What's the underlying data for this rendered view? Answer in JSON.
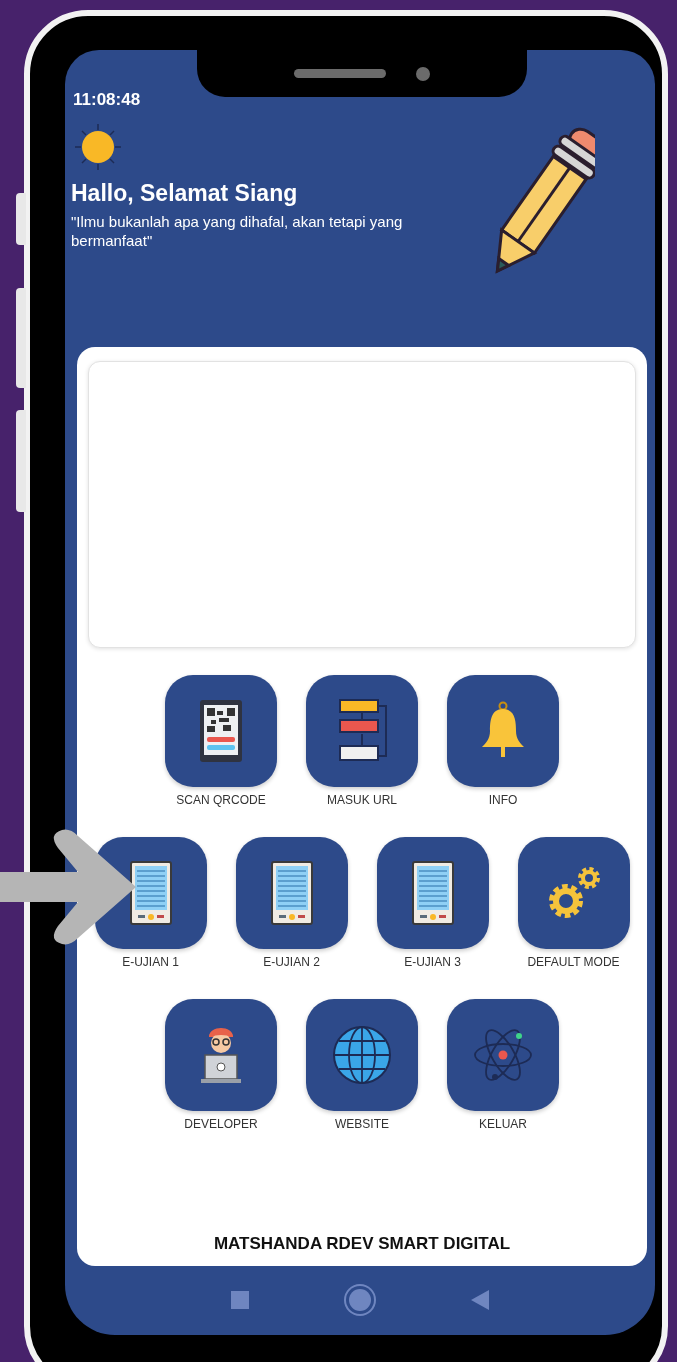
{
  "status_bar": {
    "time": "11:08:48"
  },
  "header": {
    "title": "Hallo, Selamat Siang",
    "quote": "\"Ilmu bukanlah apa yang dihafal, akan tetapi yang bermanfaat\""
  },
  "menu_rows": [
    [
      {
        "label": "SCAN QRCODE",
        "kind": "qr"
      },
      {
        "label": "MASUK URL",
        "kind": "flow"
      },
      {
        "label": "INFO",
        "kind": "bell"
      }
    ],
    [
      {
        "label": "E-UJIAN 1",
        "kind": "ebook"
      },
      {
        "label": "E-UJIAN 2",
        "kind": "ebook"
      },
      {
        "label": "E-UJIAN 3",
        "kind": "ebook"
      },
      {
        "label": "DEFAULT MODE",
        "kind": "gears"
      }
    ],
    [
      {
        "label": "DEVELOPER",
        "kind": "developer"
      },
      {
        "label": "WEBSITE",
        "kind": "globe"
      },
      {
        "label": "KELUAR",
        "kind": "atom"
      }
    ]
  ],
  "footer": {
    "text": "MATSHANDA RDEV SMART DIGITAL"
  }
}
